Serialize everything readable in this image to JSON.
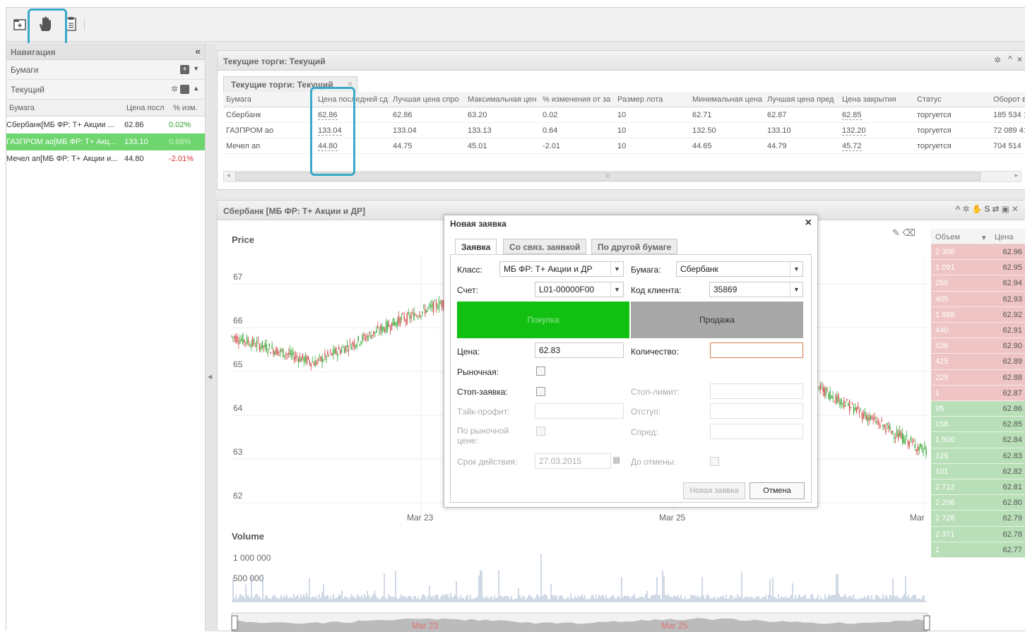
{
  "toolbar": {
    "icons": [
      "new-window-icon",
      "hand-order-icon",
      "clipboard-icon"
    ]
  },
  "nav": {
    "title": "Навигация",
    "collapse": "«",
    "securities_label": "Бумаги",
    "current_label": "Текущий",
    "grid_headers": [
      "Бумага",
      "Цена посл",
      "% изм."
    ],
    "rows": [
      {
        "name": "Сбербанк[МБ ФР: Т+ Акции ...",
        "price": "62.86",
        "change": "0.02%"
      },
      {
        "name": "ГАЗПРОМ ао[МБ ФР: Т+ Акц...",
        "price": "133.10",
        "change": "0.68%"
      },
      {
        "name": "Мечел ап[МБ ФР: Т+ Акции и...",
        "price": "44.80",
        "change": "-2.01%"
      }
    ]
  },
  "trades": {
    "title": "Текущие торги: Текущий",
    "tab": "Текущие торги: Текущий",
    "headers": [
      "Бумага",
      "Цена последней сд",
      "Лучшая цена спро",
      "Максимальная цен",
      "% изменения от за",
      "Размер лота",
      "Минимальная цена",
      "Лучшая цена пред",
      "Цена закрытия",
      "Статус",
      "Оборот в"
    ],
    "rows": [
      [
        "Сбербанк",
        "62.86",
        "62.86",
        "63.20",
        "0.02",
        "10",
        "62.71",
        "62.87",
        "62.85",
        "торгуется",
        "185 534 1"
      ],
      [
        "ГАЗПРОМ ао",
        "133.04",
        "133.04",
        "133.13",
        "0.64",
        "10",
        "132.50",
        "133.10",
        "132.20",
        "торгуется",
        "72 089 41"
      ],
      [
        "Мечел ап",
        "44.80",
        "44.75",
        "45.01",
        "-2.01",
        "10",
        "44.65",
        "44.79",
        "45.72",
        "торгуется",
        "704 514"
      ]
    ],
    "scroll_mark": "III"
  },
  "chart_panel": {
    "title": "Сбербанк [МБ ФР: Т+ Акции и ДР]",
    "price_label": "Price",
    "volume_label": "Volume",
    "y_ticks": [
      "67",
      "66",
      "65",
      "64",
      "63",
      "62"
    ],
    "x_ticks": [
      "Mar 23",
      "Mar 25",
      "Mar"
    ],
    "nav_ticks": [
      "Mar 23",
      "Mar 25"
    ],
    "vol_ticks": [
      "1 000 000",
      "500 000"
    ]
  },
  "book": {
    "header_volume": "Объем",
    "header_price": "Цена",
    "asks": [
      [
        "2 308",
        "62.96"
      ],
      [
        "1 091",
        "62.95"
      ],
      [
        "256",
        "62.94"
      ],
      [
        "405",
        "62.93"
      ],
      [
        "1 888",
        "62.92"
      ],
      [
        "440",
        "62.91"
      ],
      [
        "536",
        "62.90"
      ],
      [
        "425",
        "62.89"
      ],
      [
        "225",
        "62.88"
      ],
      [
        "1",
        "62.87"
      ]
    ],
    "bids": [
      [
        "95",
        "62.86"
      ],
      [
        "158",
        "62.85"
      ],
      [
        "1 500",
        "62.84"
      ],
      [
        "125",
        "62.83"
      ],
      [
        "101",
        "62.82"
      ],
      [
        "2 712",
        "62.81"
      ],
      [
        "2 206",
        "62.80"
      ],
      [
        "2 728",
        "62.79"
      ],
      [
        "2 371",
        "62.78"
      ],
      [
        "1",
        "62.77"
      ]
    ],
    "colors": {
      "ask": "#efc4c4",
      "bid": "#b9dfb9"
    }
  },
  "dialog": {
    "title": "Новая заявка",
    "close": "×",
    "tabs": [
      "Заявка",
      "Со связ. заявкой",
      "По другой бумаге"
    ],
    "class_label": "Класс:",
    "class_value": "МБ ФР: Т+ Акции и ДР",
    "security_label": "Бумага:",
    "security_value": "Сбербанк",
    "account_label": "Счет:",
    "account_value": "L01-00000F00",
    "client_label": "Код клиента:",
    "client_value": "35869",
    "buy": "Покупка",
    "sell": "Продажа",
    "price_label": "Цена:",
    "price_value": "62.83",
    "qty_label": "Количество:",
    "market_label": "Рыночная:",
    "stop_label": "Стоп-заявка:",
    "stop_limit_label": "Стоп-лимит:",
    "take_profit_label": "Тэйк-профит:",
    "offset_label": "Отступ:",
    "by_market_label": "По рыночной цене:",
    "spread_label": "Спред:",
    "expiry_label": "Срок действия:",
    "expiry_value": "27.03.2015",
    "until_cancel_label": "До отмены:",
    "new_order_btn": "Новая заявка",
    "cancel_btn": "Отмена",
    "colors": {
      "buy": "#11c011",
      "sell": "#a8a8a8"
    }
  }
}
